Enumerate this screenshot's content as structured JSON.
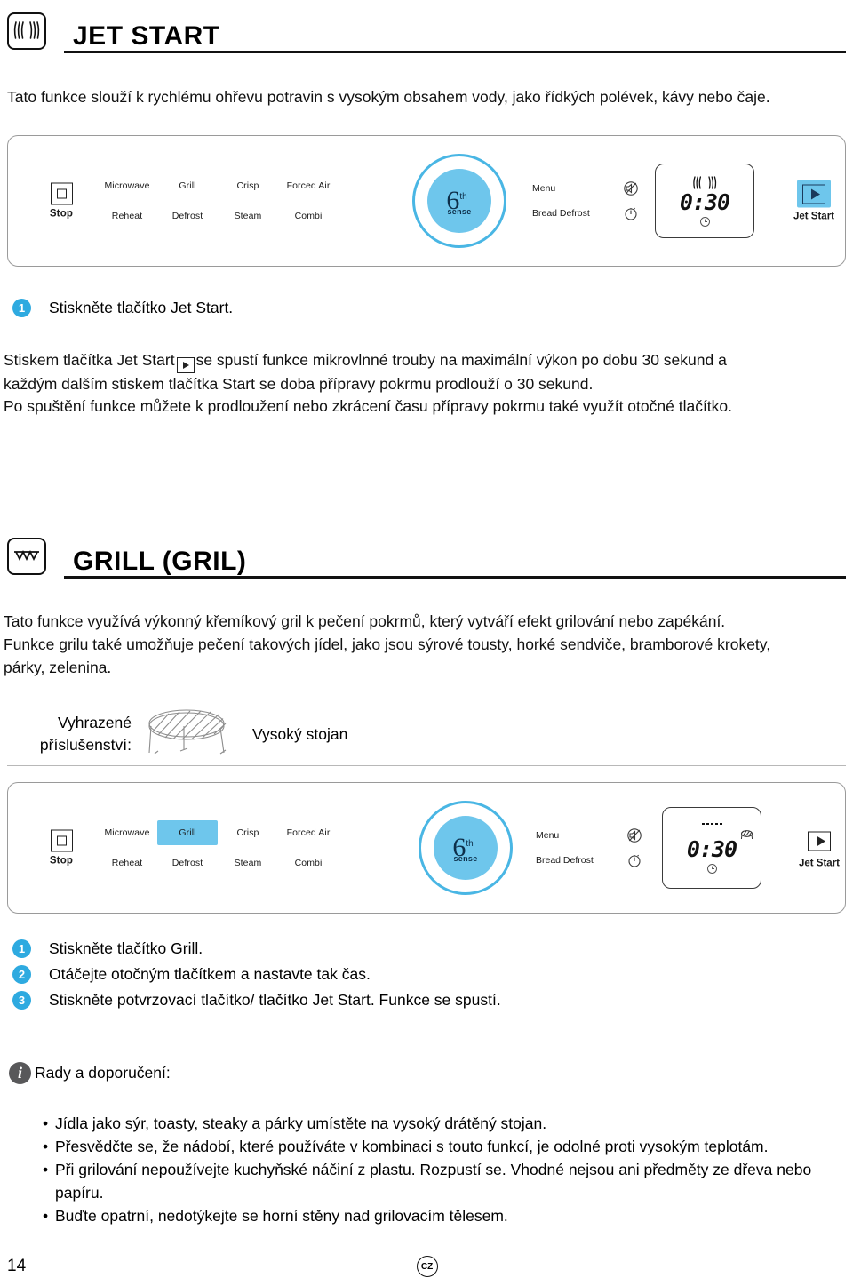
{
  "page": {
    "number": "14",
    "locale_badge": "CZ"
  },
  "sections": [
    {
      "id": "jet-start",
      "icon": "jet-start-icon",
      "title": "JET START",
      "intro": "Tato funkce slouží k rychlému ohřevu potravin s vysokým obsahem vody, jako řídkých polévek, kávy nebo čaje.",
      "steps": [
        {
          "num": "1",
          "text": "Stiskněte tlačítko Jet Start."
        }
      ],
      "body_lines": [
        "Stiskem tlačítka Jet Start",
        "se spustí funkce mikrovlnné trouby na maximální výkon po dobu 30 sekund a",
        "každým dalším stiskem tlačítka Start se doba přípravy pokrmu prodlouží o 30 sekund.",
        "Po spuštění funkce můžete k prodloužení nebo zkrácení času přípravy pokrmu také využít otočné tlačítko."
      ]
    },
    {
      "id": "grill",
      "icon": "grill-icon",
      "title": "GRILL (GRIL)",
      "body_lines": [
        "Tato funkce využívá výkonný křemíkový gril k pečení pokrmů, který vytváří efekt grilování nebo zapékání.",
        "Funkce grilu také umožňuje pečení takových jídel, jako jsou sýrové tousty, horké sendviče, bramborové krokety,",
        "párky, zelenina."
      ],
      "accessory": {
        "label_line1": "Vyhrazené",
        "label_line2": "příslušenství:",
        "icon": "wire-rack-icon",
        "name": "Vysoký stojan"
      },
      "steps": [
        {
          "num": "1",
          "text": "Stiskněte tlačítko Grill."
        },
        {
          "num": "2",
          "text": "Otáčejte otočným tlačítkem a nastavte tak čas."
        },
        {
          "num": "3",
          "text": "Stiskněte potvrzovací tlačítko/ tlačítko Jet Start. Funkce se spustí."
        }
      ],
      "tips_heading": "Rady a doporučení:",
      "tips": [
        "Jídla jako sýr, toasty, steaky a párky umístěte na vysoký drátěný stojan.",
        "Přesvědčte se, že nádobí, které používáte v kombinaci s touto funkcí, je odolné proti vysokým teplotám.",
        "Při grilování nepoužívejte kuchyňské náčiní z plastu. Rozpustí se. Vhodné nejsou ani předměty ze dřeva nebo papíru.",
        "Buďte opatrní, nedotýkejte se horní stěny nad grilovacím tělesem."
      ]
    }
  ],
  "control_panel": {
    "stop": {
      "label": "Stop",
      "icon": "stop-square-icon"
    },
    "functions_row1": [
      "Microwave",
      "Grill",
      "Crisp",
      "Forced Air"
    ],
    "functions_row2": [
      "Reheat",
      "Defrost",
      "Steam",
      "Combi"
    ],
    "dial": {
      "six": "6",
      "th": "th",
      "sense": "sense"
    },
    "menu": {
      "label": "Menu",
      "icon": "crossed-speaker-icon"
    },
    "bread_defrost": {
      "label": "Bread Defrost",
      "icon": "timer-icon"
    },
    "display": {
      "time": "0:30",
      "clock_icon": "clock-icon"
    },
    "jet_start": {
      "label": "Jet Start",
      "icon": "play-triangle-icon"
    }
  },
  "panel_states": {
    "jet_start_panel": {
      "highlight_function": "",
      "jet_start_highlighted": true,
      "display_top_icon": "steam-waves-icon"
    },
    "grill_panel": {
      "highlight_function": "Grill",
      "jet_start_highlighted": false,
      "display_top_icon": "grill-element-icon"
    }
  },
  "colors": {
    "accent": "#6ec6ec",
    "accent_dark": "#2eaae0",
    "dial_ring": "#49b6e4",
    "text": "#111111",
    "rule": "#b8b8b8",
    "info_grey": "#58585a"
  }
}
